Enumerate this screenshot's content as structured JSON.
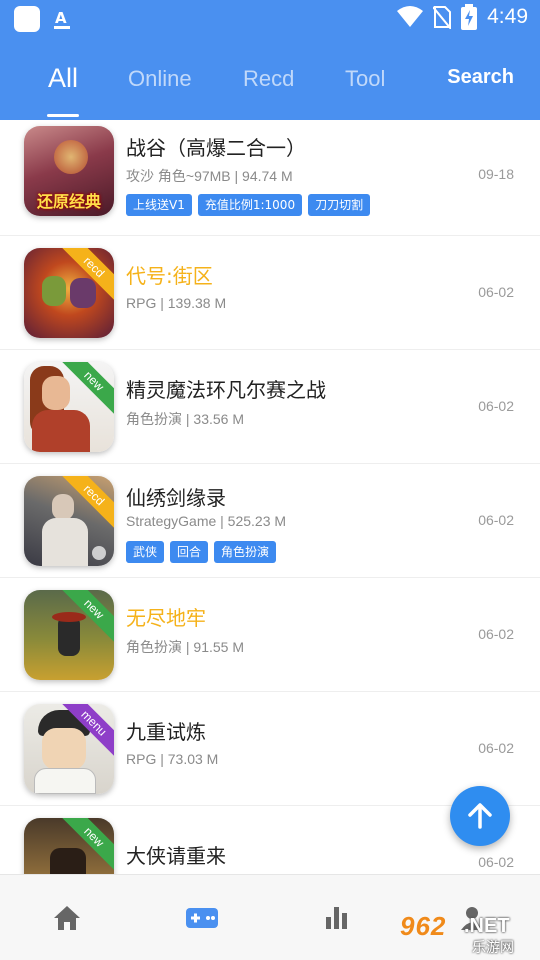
{
  "status_bar": {
    "time": "4:49",
    "keyboard_letter": "A"
  },
  "tabs": [
    {
      "label": "All",
      "active": true
    },
    {
      "label": "Online",
      "active": false
    },
    {
      "label": "Recd",
      "active": false
    },
    {
      "label": "Tool",
      "active": false
    }
  ],
  "search_label": "Search",
  "games": [
    {
      "title": "战谷（高爆二合一）",
      "meta": "攻沙 角色~97MB | 94.74 M",
      "date": "09-18",
      "highlight": false,
      "icon_text": "还原经典",
      "ribbon": "",
      "tags": [
        "上线送V1",
        "充值比例1:1000",
        "刀刀切割"
      ]
    },
    {
      "title": "代号:街区",
      "meta": "RPG | 139.38 M",
      "date": "06-02",
      "highlight": true,
      "ribbon": "recd",
      "tags": []
    },
    {
      "title": "精灵魔法环凡尔赛之战",
      "meta": "角色扮演 | 33.56 M",
      "date": "06-02",
      "highlight": false,
      "ribbon": "new",
      "tags": []
    },
    {
      "title": "仙绣剑缘录",
      "meta": "StrategyGame | 525.23 M",
      "date": "06-02",
      "highlight": false,
      "ribbon": "recd",
      "tags": [
        "武侠",
        "回合",
        "角色扮演"
      ]
    },
    {
      "title": "无尽地牢",
      "meta": "角色扮演 | 91.55 M",
      "date": "06-02",
      "highlight": true,
      "ribbon": "new",
      "tags": []
    },
    {
      "title": "九重试炼",
      "meta": "RPG | 73.03 M",
      "date": "06-02",
      "highlight": false,
      "ribbon": "menu",
      "tags": []
    },
    {
      "title": "大侠请重来",
      "meta": "",
      "date": "06-02",
      "highlight": false,
      "ribbon": "new",
      "tags": []
    }
  ],
  "ribbon_colors": {
    "recd": "#f5b21a",
    "new": "#3ba84a",
    "menu": "#8e3ec8"
  },
  "bottom_nav": [
    {
      "icon": "home-icon",
      "active": false
    },
    {
      "icon": "gamepad-icon",
      "active": true
    },
    {
      "icon": "bar-chart-icon",
      "active": false
    },
    {
      "icon": "user-icon",
      "active": false
    }
  ],
  "watermark": {
    "number": "962",
    "suffix": ".NET",
    "subtitle": "乐游网"
  },
  "colors": {
    "header": "#4a90f0",
    "tag": "#3d8af0",
    "highlight_title": "#f5b21a",
    "fab": "#2f8df0",
    "nav_active": "#4a90f0",
    "nav_inactive": "#666666"
  }
}
